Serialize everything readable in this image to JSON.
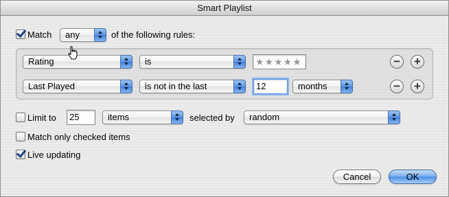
{
  "window": {
    "title": "Smart Playlist"
  },
  "match": {
    "checked": true,
    "label": "Match",
    "mode": "any",
    "suffix": "of the following rules:"
  },
  "rules": [
    {
      "field": "Rating",
      "operator": "is",
      "value": "★★★★★"
    },
    {
      "field": "Last Played",
      "operator": "is not in the last",
      "value": "12",
      "unit": "months"
    }
  ],
  "limit": {
    "checked": false,
    "label": "Limit to",
    "value": "25",
    "unit": "items",
    "selected_by_label": "selected by",
    "selected_by": "random"
  },
  "match_only_checked": {
    "checked": false,
    "label": "Match only checked items"
  },
  "live_updating": {
    "checked": true,
    "label": "Live updating"
  },
  "buttons": {
    "cancel": "Cancel",
    "ok": "OK"
  },
  "icons": {
    "remove": "minus-icon",
    "add": "plus-icon",
    "cursor": "hand-pointer-icon"
  },
  "colors": {
    "accent": "#4b8fe6",
    "check": "#1f3e8a"
  }
}
